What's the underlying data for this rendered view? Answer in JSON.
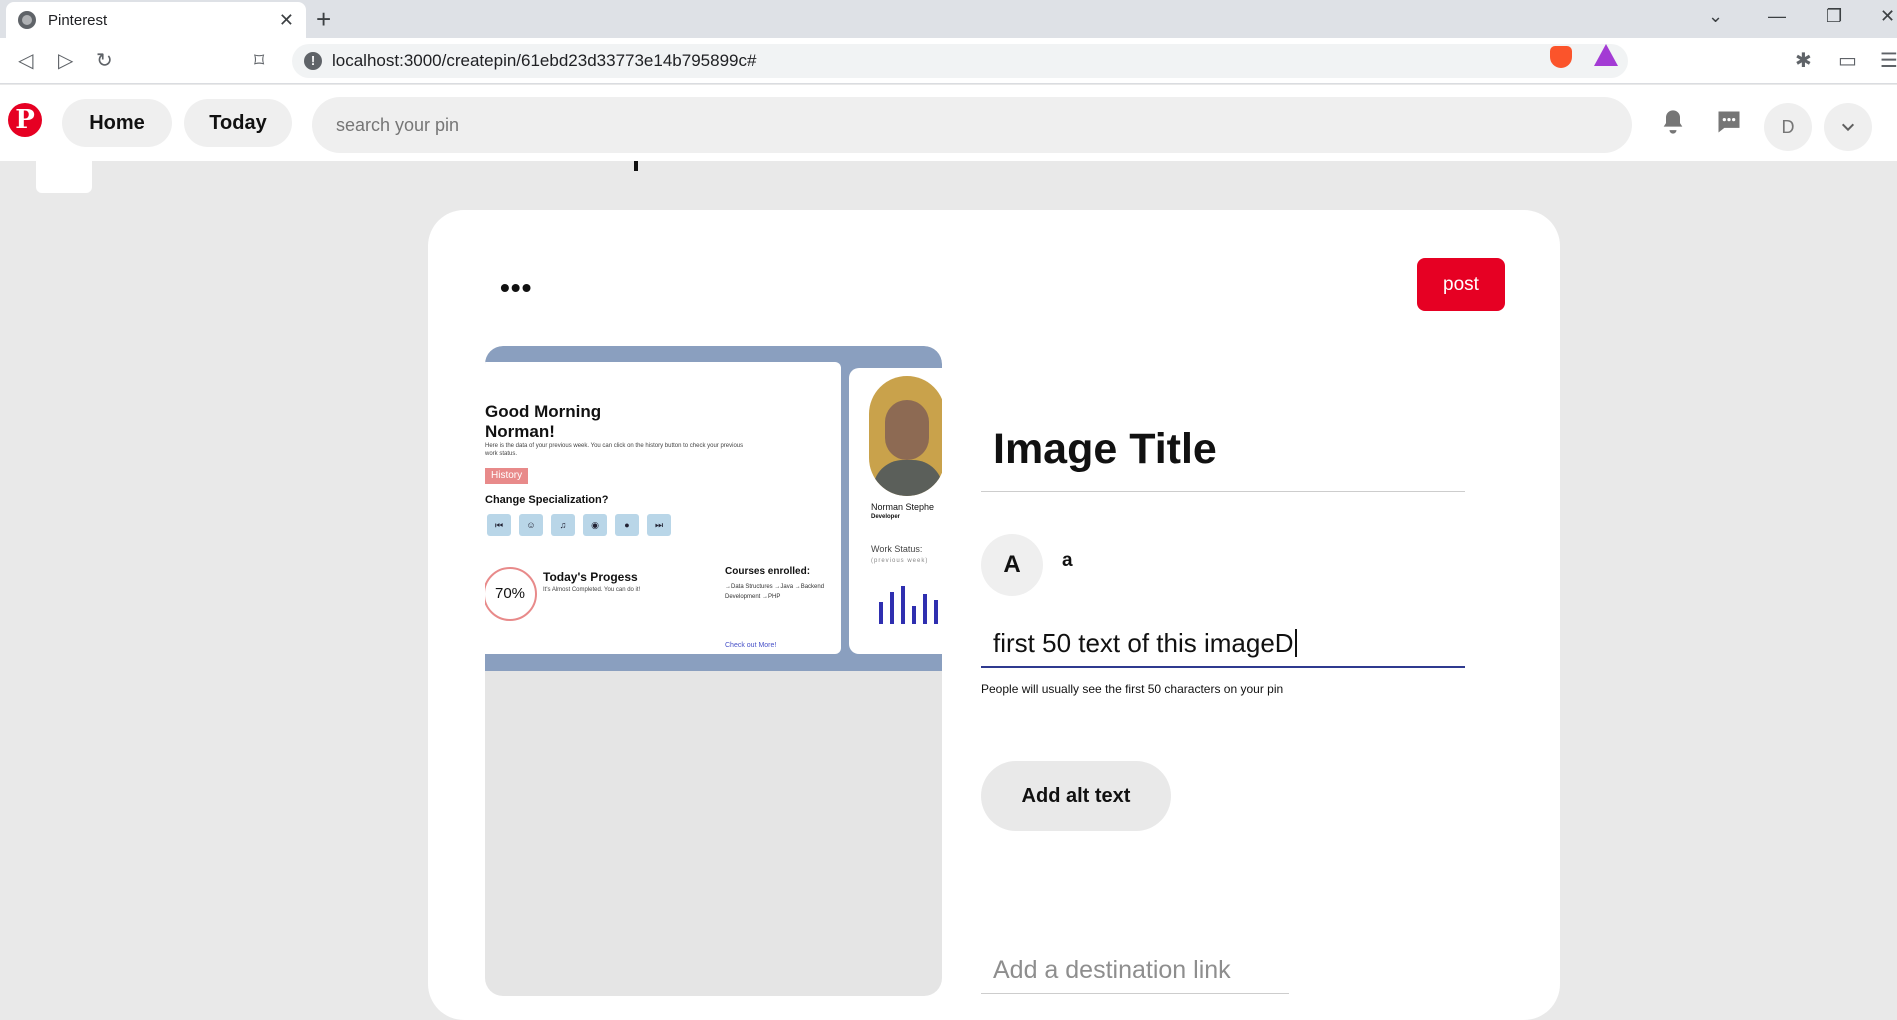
{
  "browser": {
    "tab_title": "Pinterest",
    "tab_close": "✕",
    "new_tab": "+",
    "url": "localhost:3000/createpin/61ebd23d33773e14b795899c#"
  },
  "header": {
    "logo": "P",
    "home_label": "Home",
    "today_label": "Today",
    "search_placeholder": "search your pin",
    "avatar_initial": "D"
  },
  "pin_form": {
    "more_label": "•••",
    "post_label": "post",
    "title": "Image Title",
    "user_initial": "A",
    "user_name": "a",
    "description": "first 50 text of this imageD",
    "description_help": "People will usually see the first 50 characters on your pin",
    "alt_text_label": "Add alt text",
    "link_placeholder": "Add a destination link"
  },
  "preview": {
    "greeting": "Good Morning Norman!",
    "subtext": "Here is the data of your previous week. You can click on the history button to check your previous work status.",
    "history": "History",
    "specialization": "Change Specialization?",
    "progress_pct": "70%",
    "progress_title": "Today's Progess",
    "progress_sub": "It's Almost Completed. You can do it!",
    "courses_title": "Courses enrolled:",
    "courses": "→Data Structures →Java →Backend Development →PHP",
    "check_more": "Check out More!",
    "person_name": "Norman Stephe",
    "person_role": "Developer",
    "work_status": "Work Status:",
    "work_sub": "(previous week)"
  },
  "colors": {
    "brand_red": "#e60023",
    "active_underline": "#2f3a8f"
  }
}
